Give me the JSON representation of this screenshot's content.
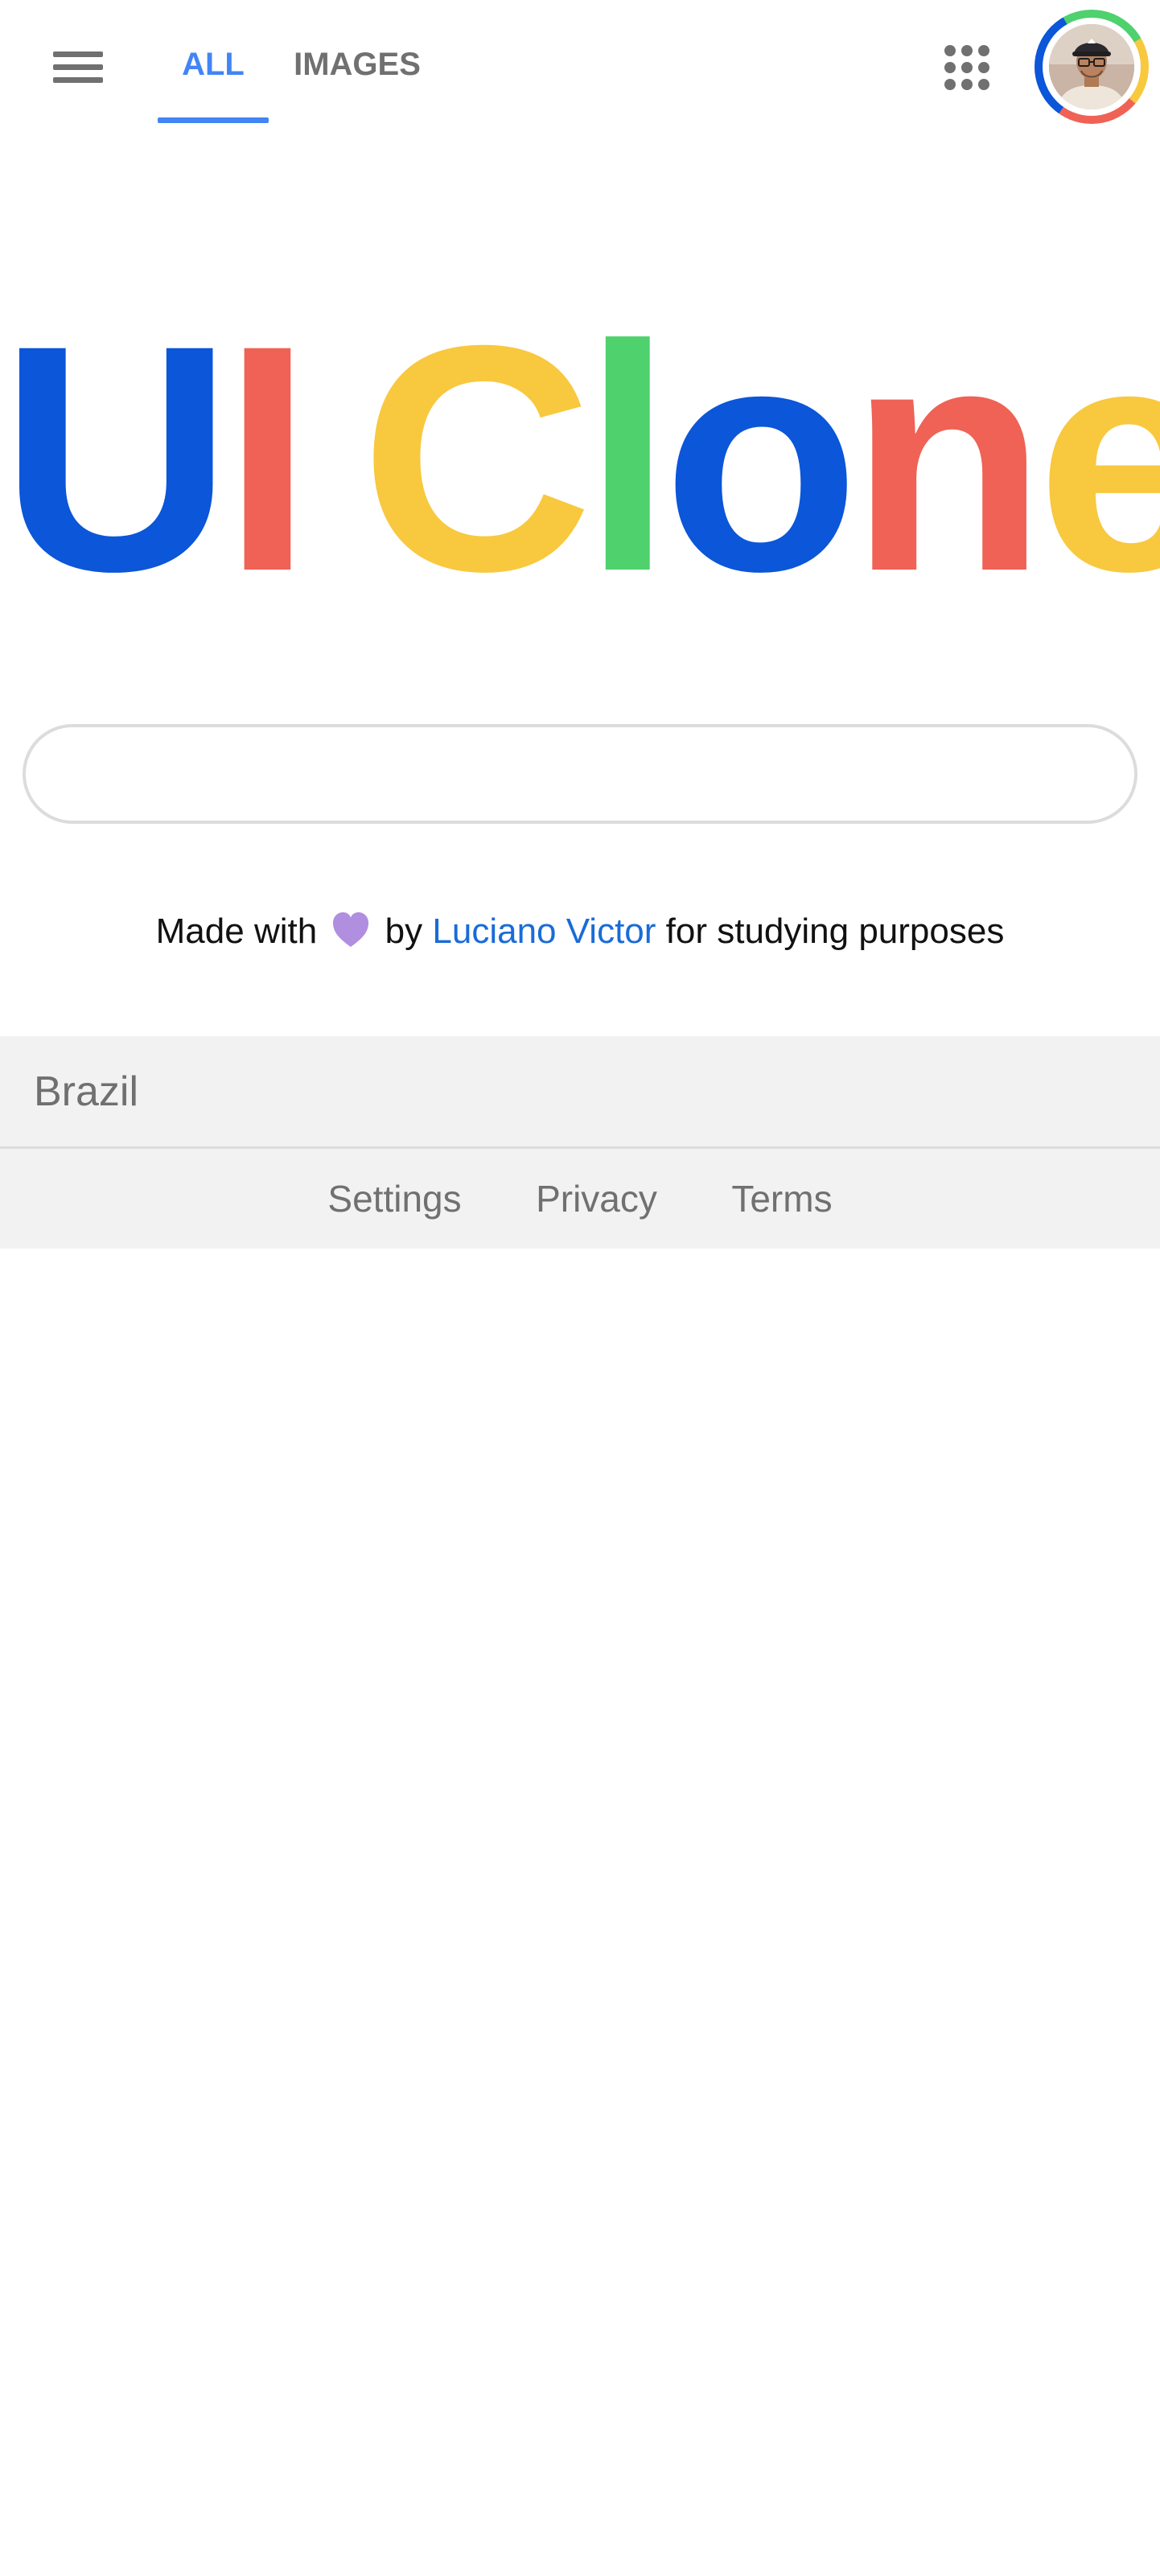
{
  "header": {
    "menu_icon": "hamburger-menu-icon",
    "apps_icon": "apps-grid-icon",
    "tabs": [
      {
        "label": "ALL",
        "active": true
      },
      {
        "label": "IMAGES",
        "active": false
      }
    ],
    "active_tab_color": "#4285f4",
    "inactive_tab_color": "#707070"
  },
  "logo": {
    "letters": [
      {
        "char": "U",
        "color": "#0b56d9"
      },
      {
        "char": "I",
        "color": "#ef6255"
      },
      {
        "char": " ",
        "color": "#ffffff"
      },
      {
        "char": "C",
        "color": "#f8c83e"
      },
      {
        "char": "l",
        "color": "#4fd16d"
      },
      {
        "char": "o",
        "color": "#0b56d9"
      },
      {
        "char": "n",
        "color": "#ef6255"
      },
      {
        "char": "e",
        "color": "#f8c83e"
      }
    ]
  },
  "search": {
    "value": "",
    "placeholder": ""
  },
  "credit": {
    "prefix": "Made with",
    "heart_icon": "purple-heart-icon",
    "heart_color": "#b08ee0",
    "middle": "by",
    "author": "Luciano Victor",
    "suffix": "for studying purposes",
    "link_color": "#1a6bd8"
  },
  "footer": {
    "country": "Brazil",
    "links": [
      "Settings",
      "Privacy",
      "Terms"
    ]
  }
}
